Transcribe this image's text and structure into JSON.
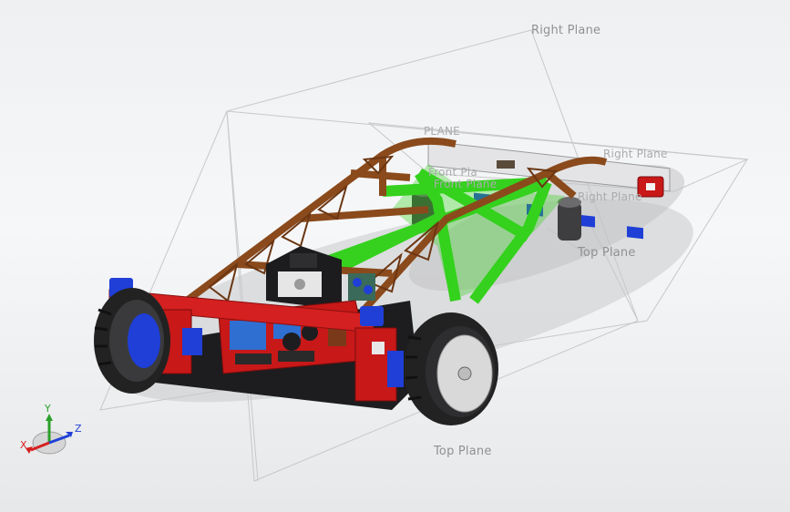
{
  "planes": {
    "right_main": "Right Plane",
    "right_ghost_1": "Right Plane",
    "right_ghost_2": "Right Plane",
    "front_ghost_1": "Front Pla",
    "front_ghost_2": "Front Plane",
    "plane_ghost": "PLANE",
    "top_main": "Top Plane",
    "top_rear": "Top Plane"
  },
  "triad": {
    "x": "X",
    "y": "Y",
    "z": "Z"
  },
  "colors": {
    "background": "#eef0f2",
    "frame_brown": "#8a4a1c",
    "frame_green": "#35d11e",
    "frame_red": "#d42020",
    "connector_blue": "#1f3fd6",
    "board_red": "#c81818",
    "tire": "#222222",
    "hub": "#d9d9d9",
    "plane_outline": "#c8c8c8"
  },
  "icons": [
    "triad-icon"
  ]
}
